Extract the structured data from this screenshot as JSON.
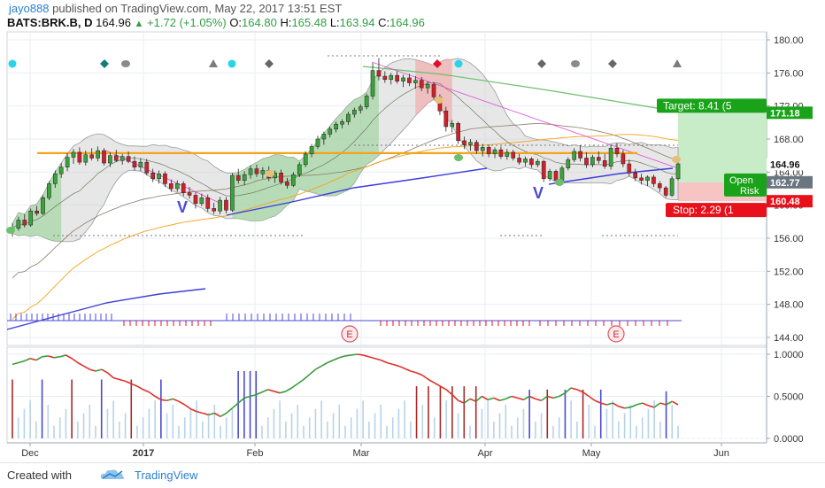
{
  "header": {
    "user": "jayo888",
    "published_text": "published on TradingView.com, May 22, 2017 13:51 EST",
    "symbol": "BATS:BRK.B, D",
    "last": "164.96",
    "change": "+1.72 (+1.05%)",
    "o_label": "O:",
    "o_value": "164.80",
    "h_label": "H:",
    "h_value": "165.48",
    "l_label": "L:",
    "l_value": "163.94",
    "c_label": "C:",
    "c_value": "164.96"
  },
  "footer": {
    "created_with": "Created with",
    "brand": "TradingView"
  },
  "colors": {
    "up": "#3ba33b",
    "down": "#d0202a",
    "grid": "#e9eef4",
    "orange": "#f5a21b",
    "blue_ma": "#3d3ddb",
    "green_ma": "#6cbf6c",
    "target": "#1aa31a",
    "stop": "#e8101a",
    "price_tag": "#1e2d3a"
  },
  "chart_data": [
    {
      "type": "candlestick",
      "title": "BATS:BRK.B, D",
      "price_axis": {
        "ticks": [
          "180.00",
          "176.00",
          "172.00",
          "168.00",
          "164.00",
          "160.00",
          "156.00",
          "152.00",
          "148.00",
          "144.00"
        ],
        "ylim": [
          143,
          181
        ]
      },
      "x_axis": {
        "tick_labels": [
          "Dec",
          "2017",
          "Feb",
          "Mar",
          "Apr",
          "May",
          "Jun"
        ]
      },
      "candles": [
        {
          "o": 156.8,
          "h": 157.8,
          "l": 156.2,
          "c": 157.2
        },
        {
          "o": 157.2,
          "h": 158.6,
          "l": 156.9,
          "c": 158.2
        },
        {
          "o": 158.2,
          "h": 158.9,
          "l": 157.3,
          "c": 157.6
        },
        {
          "o": 157.6,
          "h": 159.6,
          "l": 157.4,
          "c": 159.3
        },
        {
          "o": 159.3,
          "h": 159.9,
          "l": 158.7,
          "c": 159.0
        },
        {
          "o": 159.0,
          "h": 161.2,
          "l": 158.8,
          "c": 160.9
        },
        {
          "o": 160.9,
          "h": 162.9,
          "l": 160.6,
          "c": 162.6
        },
        {
          "o": 162.6,
          "h": 164.2,
          "l": 162.1,
          "c": 163.8
        },
        {
          "o": 163.8,
          "h": 165.1,
          "l": 163.3,
          "c": 164.6
        },
        {
          "o": 164.6,
          "h": 166.3,
          "l": 164.1,
          "c": 165.8
        },
        {
          "o": 165.8,
          "h": 166.8,
          "l": 165.0,
          "c": 166.4
        },
        {
          "o": 166.4,
          "h": 167.0,
          "l": 164.9,
          "c": 165.2
        },
        {
          "o": 165.2,
          "h": 166.6,
          "l": 164.8,
          "c": 166.1
        },
        {
          "o": 166.1,
          "h": 166.9,
          "l": 165.4,
          "c": 165.7
        },
        {
          "o": 165.7,
          "h": 167.1,
          "l": 165.3,
          "c": 166.6
        },
        {
          "o": 166.6,
          "h": 166.9,
          "l": 164.8,
          "c": 165.1
        },
        {
          "o": 165.1,
          "h": 166.4,
          "l": 164.6,
          "c": 166.0
        },
        {
          "o": 166.0,
          "h": 166.7,
          "l": 165.2,
          "c": 165.4
        },
        {
          "o": 165.4,
          "h": 166.2,
          "l": 164.9,
          "c": 165.9
        },
        {
          "o": 165.9,
          "h": 166.5,
          "l": 165.1,
          "c": 165.3
        },
        {
          "o": 165.3,
          "h": 165.9,
          "l": 164.2,
          "c": 164.6
        },
        {
          "o": 164.6,
          "h": 165.7,
          "l": 164.1,
          "c": 165.2
        },
        {
          "o": 165.2,
          "h": 165.6,
          "l": 163.6,
          "c": 163.9
        },
        {
          "o": 163.9,
          "h": 164.4,
          "l": 162.8,
          "c": 163.2
        },
        {
          "o": 163.2,
          "h": 164.2,
          "l": 162.6,
          "c": 163.8
        },
        {
          "o": 163.8,
          "h": 164.1,
          "l": 162.2,
          "c": 162.6
        },
        {
          "o": 162.6,
          "h": 163.1,
          "l": 161.6,
          "c": 162.0
        },
        {
          "o": 162.0,
          "h": 163.0,
          "l": 161.6,
          "c": 162.6
        },
        {
          "o": 162.6,
          "h": 162.9,
          "l": 161.1,
          "c": 161.5
        },
        {
          "o": 161.5,
          "h": 162.2,
          "l": 160.8,
          "c": 161.2
        },
        {
          "o": 161.2,
          "h": 161.6,
          "l": 159.6,
          "c": 160.2
        },
        {
          "o": 160.2,
          "h": 161.4,
          "l": 159.9,
          "c": 160.9
        },
        {
          "o": 160.9,
          "h": 161.3,
          "l": 159.2,
          "c": 159.6
        },
        {
          "o": 159.6,
          "h": 160.3,
          "l": 158.9,
          "c": 159.3
        },
        {
          "o": 159.3,
          "h": 161.0,
          "l": 158.9,
          "c": 160.6
        },
        {
          "o": 160.6,
          "h": 161.0,
          "l": 159.0,
          "c": 159.4
        },
        {
          "o": 159.4,
          "h": 163.9,
          "l": 159.2,
          "c": 163.6
        },
        {
          "o": 163.6,
          "h": 164.4,
          "l": 162.6,
          "c": 163.0
        },
        {
          "o": 163.0,
          "h": 164.1,
          "l": 162.4,
          "c": 163.7
        },
        {
          "o": 163.7,
          "h": 164.8,
          "l": 163.2,
          "c": 164.4
        },
        {
          "o": 164.4,
          "h": 164.9,
          "l": 163.4,
          "c": 163.8
        },
        {
          "o": 163.8,
          "h": 164.6,
          "l": 163.2,
          "c": 164.2
        },
        {
          "o": 164.2,
          "h": 164.7,
          "l": 162.9,
          "c": 163.3
        },
        {
          "o": 163.3,
          "h": 164.2,
          "l": 162.7,
          "c": 163.9
        },
        {
          "o": 163.9,
          "h": 164.3,
          "l": 162.5,
          "c": 162.8
        },
        {
          "o": 162.8,
          "h": 163.3,
          "l": 162.0,
          "c": 162.4
        },
        {
          "o": 162.4,
          "h": 164.0,
          "l": 162.2,
          "c": 163.7
        },
        {
          "o": 163.7,
          "h": 165.2,
          "l": 163.4,
          "c": 164.9
        },
        {
          "o": 164.9,
          "h": 166.5,
          "l": 164.6,
          "c": 166.2
        },
        {
          "o": 166.2,
          "h": 167.4,
          "l": 165.8,
          "c": 167.1
        },
        {
          "o": 167.1,
          "h": 168.4,
          "l": 166.8,
          "c": 168.0
        },
        {
          "o": 168.0,
          "h": 168.9,
          "l": 167.3,
          "c": 168.6
        },
        {
          "o": 168.6,
          "h": 169.5,
          "l": 168.2,
          "c": 169.2
        },
        {
          "o": 169.2,
          "h": 170.1,
          "l": 168.8,
          "c": 169.8
        },
        {
          "o": 169.8,
          "h": 170.4,
          "l": 169.3,
          "c": 170.1
        },
        {
          "o": 170.1,
          "h": 171.3,
          "l": 169.7,
          "c": 171.0
        },
        {
          "o": 171.0,
          "h": 171.8,
          "l": 170.6,
          "c": 171.5
        },
        {
          "o": 171.5,
          "h": 172.2,
          "l": 171.1,
          "c": 171.9
        },
        {
          "o": 171.9,
          "h": 173.5,
          "l": 171.6,
          "c": 173.2
        },
        {
          "o": 173.2,
          "h": 177.2,
          "l": 172.8,
          "c": 176.3
        },
        {
          "o": 176.3,
          "h": 177.8,
          "l": 175.1,
          "c": 175.6
        },
        {
          "o": 175.6,
          "h": 176.2,
          "l": 174.8,
          "c": 175.2
        },
        {
          "o": 175.2,
          "h": 176.0,
          "l": 174.6,
          "c": 175.7
        },
        {
          "o": 175.7,
          "h": 176.2,
          "l": 174.7,
          "c": 175.0
        },
        {
          "o": 175.0,
          "h": 175.8,
          "l": 174.3,
          "c": 175.4
        },
        {
          "o": 175.4,
          "h": 175.9,
          "l": 174.4,
          "c": 174.8
        },
        {
          "o": 174.8,
          "h": 175.6,
          "l": 174.1,
          "c": 175.1
        },
        {
          "o": 175.1,
          "h": 175.5,
          "l": 173.8,
          "c": 174.2
        },
        {
          "o": 174.2,
          "h": 175.0,
          "l": 173.5,
          "c": 174.6
        },
        {
          "o": 174.6,
          "h": 174.9,
          "l": 172.8,
          "c": 173.1
        },
        {
          "o": 173.1,
          "h": 173.4,
          "l": 170.9,
          "c": 171.4
        },
        {
          "o": 171.4,
          "h": 171.9,
          "l": 168.9,
          "c": 169.5
        },
        {
          "o": 169.5,
          "h": 170.3,
          "l": 168.8,
          "c": 169.9
        },
        {
          "o": 169.9,
          "h": 170.1,
          "l": 167.4,
          "c": 167.8
        },
        {
          "o": 167.8,
          "h": 168.3,
          "l": 166.8,
          "c": 167.3
        },
        {
          "o": 167.3,
          "h": 168.0,
          "l": 166.6,
          "c": 167.6
        },
        {
          "o": 167.6,
          "h": 167.9,
          "l": 166.2,
          "c": 166.6
        },
        {
          "o": 166.6,
          "h": 167.4,
          "l": 165.9,
          "c": 167.0
        },
        {
          "o": 167.0,
          "h": 167.3,
          "l": 165.8,
          "c": 166.2
        },
        {
          "o": 166.2,
          "h": 167.0,
          "l": 165.7,
          "c": 166.7
        },
        {
          "o": 166.7,
          "h": 167.1,
          "l": 165.6,
          "c": 165.9
        },
        {
          "o": 165.9,
          "h": 166.8,
          "l": 165.5,
          "c": 166.4
        },
        {
          "o": 166.4,
          "h": 166.7,
          "l": 165.4,
          "c": 165.7
        },
        {
          "o": 165.7,
          "h": 166.2,
          "l": 164.9,
          "c": 165.2
        },
        {
          "o": 165.2,
          "h": 165.9,
          "l": 164.7,
          "c": 165.6
        },
        {
          "o": 165.6,
          "h": 165.8,
          "l": 164.5,
          "c": 164.9
        },
        {
          "o": 164.9,
          "h": 165.6,
          "l": 164.6,
          "c": 165.3
        },
        {
          "o": 165.3,
          "h": 165.5,
          "l": 162.8,
          "c": 163.2
        },
        {
          "o": 163.2,
          "h": 164.4,
          "l": 162.9,
          "c": 164.1
        },
        {
          "o": 164.1,
          "h": 164.3,
          "l": 162.6,
          "c": 163.0
        },
        {
          "o": 163.0,
          "h": 164.8,
          "l": 162.8,
          "c": 164.5
        },
        {
          "o": 164.5,
          "h": 165.8,
          "l": 164.2,
          "c": 165.5
        },
        {
          "o": 165.5,
          "h": 166.9,
          "l": 165.2,
          "c": 166.5
        },
        {
          "o": 166.5,
          "h": 167.2,
          "l": 165.3,
          "c": 165.7
        },
        {
          "o": 165.7,
          "h": 166.4,
          "l": 164.5,
          "c": 164.9
        },
        {
          "o": 164.9,
          "h": 166.1,
          "l": 164.6,
          "c": 165.8
        },
        {
          "o": 165.8,
          "h": 166.5,
          "l": 165.0,
          "c": 165.4
        },
        {
          "o": 165.4,
          "h": 166.2,
          "l": 164.4,
          "c": 164.7
        },
        {
          "o": 164.7,
          "h": 167.3,
          "l": 164.3,
          "c": 166.9
        },
        {
          "o": 166.9,
          "h": 167.5,
          "l": 165.8,
          "c": 166.2
        },
        {
          "o": 166.2,
          "h": 166.7,
          "l": 164.6,
          "c": 165.0
        },
        {
          "o": 165.0,
          "h": 165.5,
          "l": 163.5,
          "c": 163.9
        },
        {
          "o": 163.9,
          "h": 164.4,
          "l": 162.9,
          "c": 163.3
        },
        {
          "o": 163.3,
          "h": 163.8,
          "l": 162.5,
          "c": 163.0
        },
        {
          "o": 163.0,
          "h": 163.6,
          "l": 162.3,
          "c": 163.4
        },
        {
          "o": 163.4,
          "h": 163.7,
          "l": 162.2,
          "c": 162.6
        },
        {
          "o": 162.6,
          "h": 162.9,
          "l": 161.6,
          "c": 162.1
        },
        {
          "o": 162.1,
          "h": 162.3,
          "l": 160.9,
          "c": 161.2
        },
        {
          "o": 161.2,
          "h": 163.5,
          "l": 161.0,
          "c": 163.2
        },
        {
          "o": 163.2,
          "h": 165.5,
          "l": 163.0,
          "c": 165.0
        }
      ],
      "price_labels": {
        "last": "164.96",
        "level": "162.77",
        "target_level": "171.18",
        "stop_level": "160.48"
      },
      "annotations": {
        "target": "Target: 8.41 (5",
        "open": "Open",
        "risk": "Risk",
        "stop": "Stop: 2.29 (1",
        "earnings": "E"
      },
      "horizontal_line": 166.3,
      "target_price": 171.18,
      "entry_price": 162.77,
      "stop_price": 160.48
    },
    {
      "type": "line",
      "title": "",
      "y_axis": {
        "ticks": [
          "1.0000",
          "0.5000",
          "0.0000"
        ],
        "ylim": [
          -0.05,
          1.05
        ]
      },
      "oscillator": [
        0.88,
        0.9,
        0.92,
        0.95,
        0.93,
        0.97,
        0.98,
        0.96,
        0.97,
        0.99,
        0.95,
        0.9,
        0.86,
        0.82,
        0.8,
        0.82,
        0.78,
        0.72,
        0.7,
        0.68,
        0.65,
        0.62,
        0.58,
        0.55,
        0.5,
        0.46,
        0.45,
        0.47,
        0.44,
        0.4,
        0.35,
        0.32,
        0.3,
        0.28,
        0.3,
        0.26,
        0.3,
        0.36,
        0.42,
        0.48,
        0.5,
        0.52,
        0.55,
        0.58,
        0.56,
        0.54,
        0.56,
        0.6,
        0.65,
        0.7,
        0.76,
        0.82,
        0.86,
        0.9,
        0.93,
        0.96,
        0.98,
        0.99,
        1.0,
        0.99,
        0.97,
        0.95,
        0.93,
        0.9,
        0.88,
        0.86,
        0.83,
        0.8,
        0.78,
        0.75,
        0.7,
        0.66,
        0.62,
        0.58,
        0.52,
        0.45,
        0.42,
        0.47,
        0.44,
        0.5,
        0.46,
        0.48,
        0.45,
        0.47,
        0.5,
        0.48,
        0.46,
        0.5,
        0.47,
        0.45,
        0.5,
        0.48,
        0.5,
        0.54,
        0.6,
        0.58,
        0.55,
        0.5,
        0.45,
        0.42,
        0.4,
        0.42,
        0.38,
        0.36,
        0.37,
        0.4,
        0.42,
        0.39,
        0.37,
        0.42,
        0.4,
        0.44,
        0.4
      ]
    }
  ]
}
